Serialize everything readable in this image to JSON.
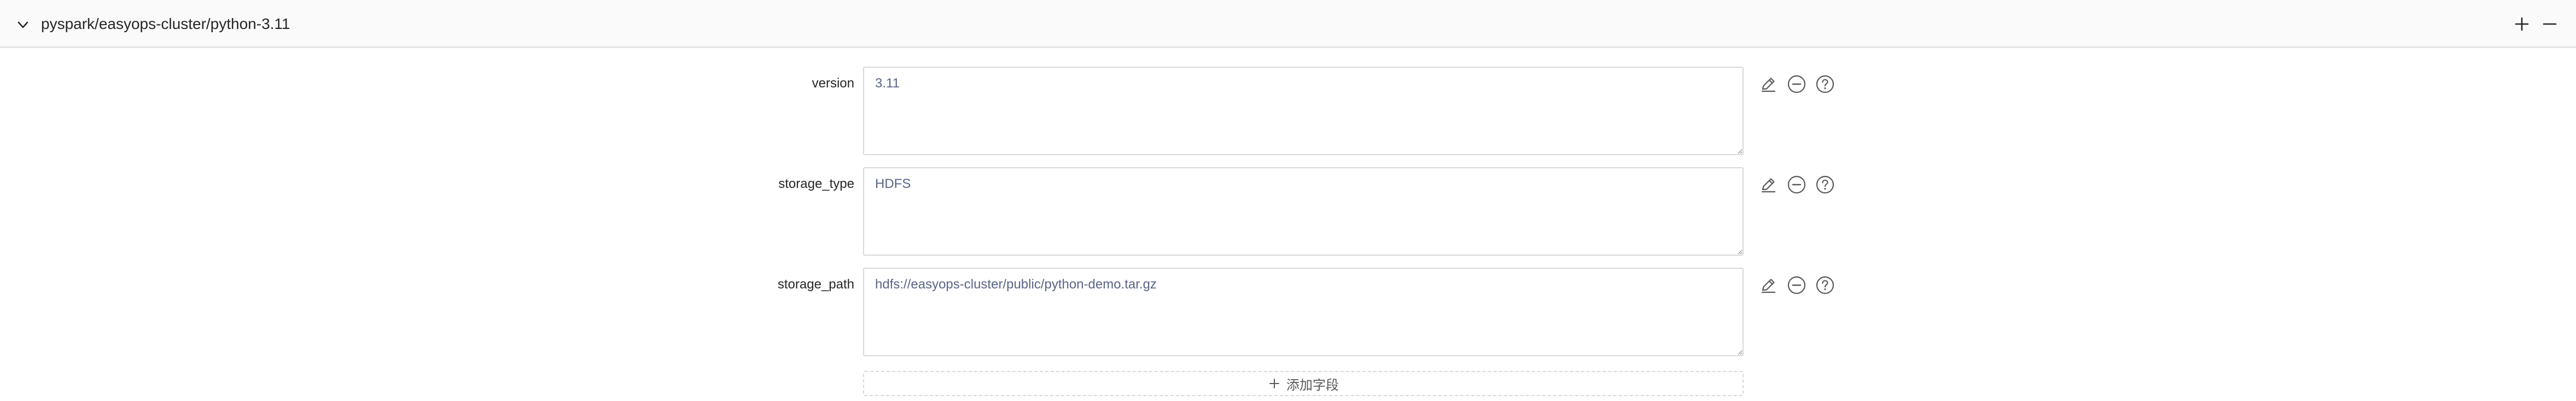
{
  "panel": {
    "title": "pyspark/easyops-cluster/python-3.11",
    "collapse_icon": "chevron-down-icon",
    "add_icon": "plus-icon",
    "remove_icon": "minus-icon"
  },
  "fields": [
    {
      "label": "version",
      "value": "3.11"
    },
    {
      "label": "storage_type",
      "value": "HDFS"
    },
    {
      "label": "storage_path",
      "value": "hdfs://easyops-cluster/public/python-demo.tar.gz"
    }
  ],
  "field_action_icons": [
    "edit-icon",
    "remove-circle-icon",
    "help-circle-icon"
  ],
  "add_field": {
    "label": "添加字段",
    "icon": "plus-icon"
  },
  "colors": {
    "header_bg": "#fafafa",
    "text_primary": "#262626",
    "value_text": "#5a6585",
    "border": "#d9d9d9",
    "icon": "#595959"
  }
}
